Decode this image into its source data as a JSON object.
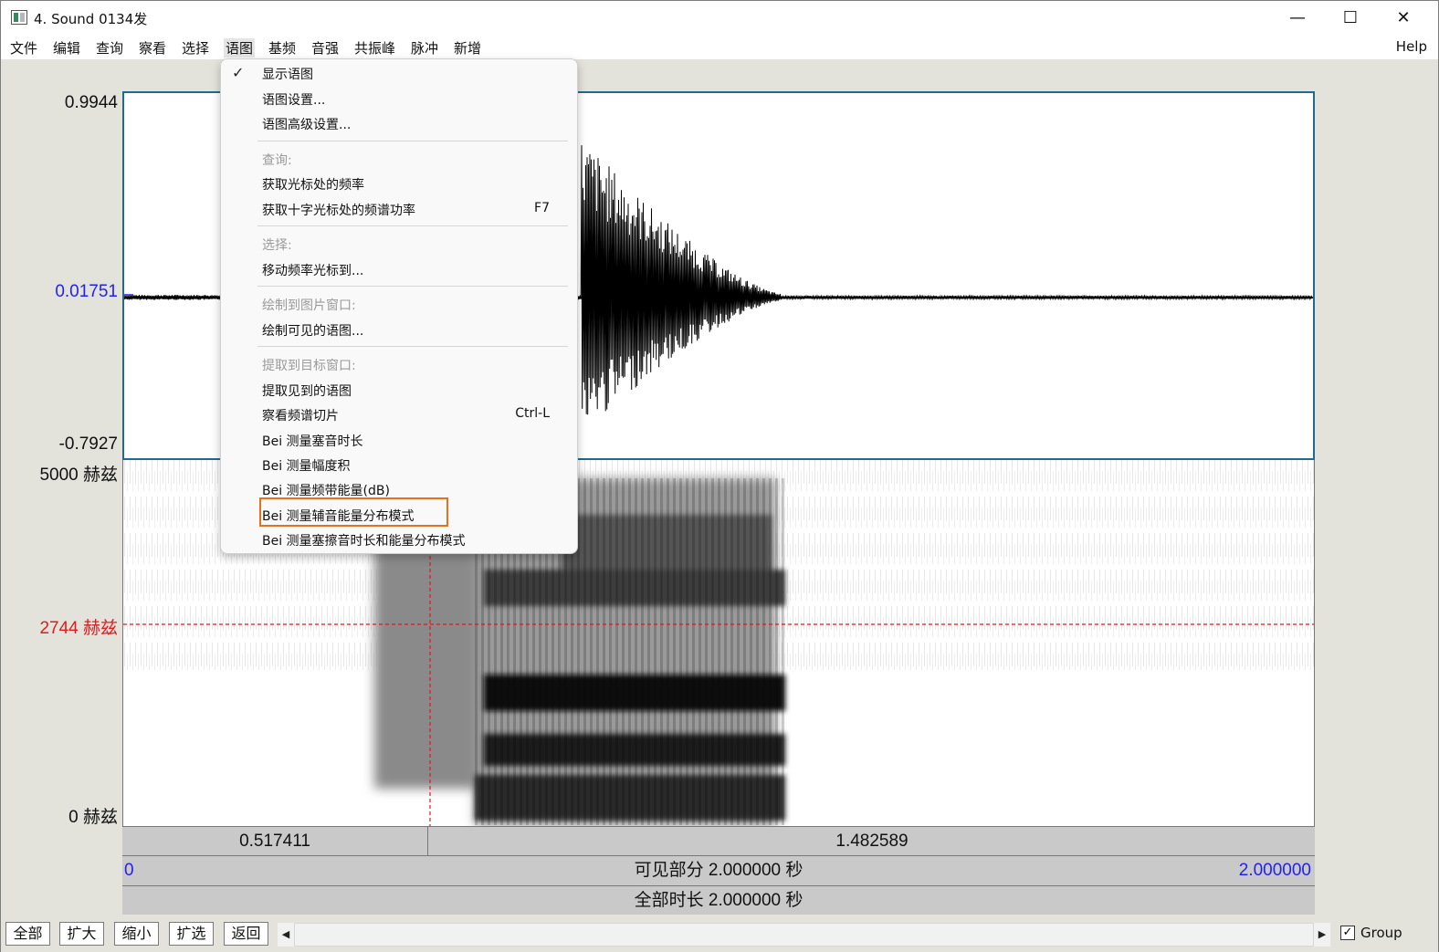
{
  "window": {
    "title": "4. Sound 0134发",
    "controls": {
      "minimize": "—",
      "maximize": "☐",
      "close": "✕"
    }
  },
  "menubar": {
    "items": [
      "文件",
      "编辑",
      "查询",
      "察看",
      "选择",
      "语图",
      "基频",
      "音强",
      "共振峰",
      "脉冲",
      "新增"
    ],
    "active": "语图",
    "help": "Help"
  },
  "waveform": {
    "y_max": "0.9944",
    "y_cursor": "0.01751",
    "y_min": "-0.7927"
  },
  "spectrogram": {
    "y_max": "5000 赫兹",
    "y_cursor": "2744 赫兹",
    "y_min": "0 赫兹"
  },
  "timebars": {
    "cursor_left": "0.517411",
    "cursor_right": "1.482589",
    "visible_start": "0",
    "visible_label": "可见部分 2.000000 秒",
    "visible_end": "2.000000",
    "total_label": "全部时长 2.000000 秒"
  },
  "bottom": {
    "buttons": [
      "全部",
      "扩大",
      "缩小",
      "扩选",
      "返回"
    ],
    "scroll_left": "◀",
    "scroll_right": "▶",
    "group_label": "Group",
    "group_checked": true
  },
  "dropdown": {
    "check": "✓",
    "items": [
      {
        "label": "显示语图",
        "checked": true
      },
      {
        "label": "语图设置..."
      },
      {
        "label": "语图高级设置..."
      },
      {
        "label": "查询:",
        "disabled": true
      },
      {
        "label": "获取光标处的频率"
      },
      {
        "label": "获取十字光标处的频谱功率",
        "shortcut": "F7"
      },
      {
        "label": "选择:",
        "disabled": true
      },
      {
        "label": "移动频率光标到..."
      },
      {
        "label": "绘制到图片窗口:",
        "disabled": true
      },
      {
        "label": "绘制可见的语图..."
      },
      {
        "label": "提取到目标窗口:",
        "disabled": true
      },
      {
        "label": "提取见到的语图"
      },
      {
        "label": "察看频谱切片",
        "shortcut": "Ctrl-L"
      },
      {
        "label": "Bei 测量塞音时长"
      },
      {
        "label": "Bei 测量幅度积"
      },
      {
        "label": "Bei 测量频带能量(dB)"
      },
      {
        "label": "Bei 测量辅音能量分布模式",
        "highlighted": true
      },
      {
        "label": "Bei 测量塞擦音时长和能量分布模式"
      }
    ]
  },
  "colors": {
    "cursor": "#e11a1a",
    "blue_label": "#2222ee",
    "highlight": "#e7711b",
    "wave_border": "#1f6a8d"
  }
}
